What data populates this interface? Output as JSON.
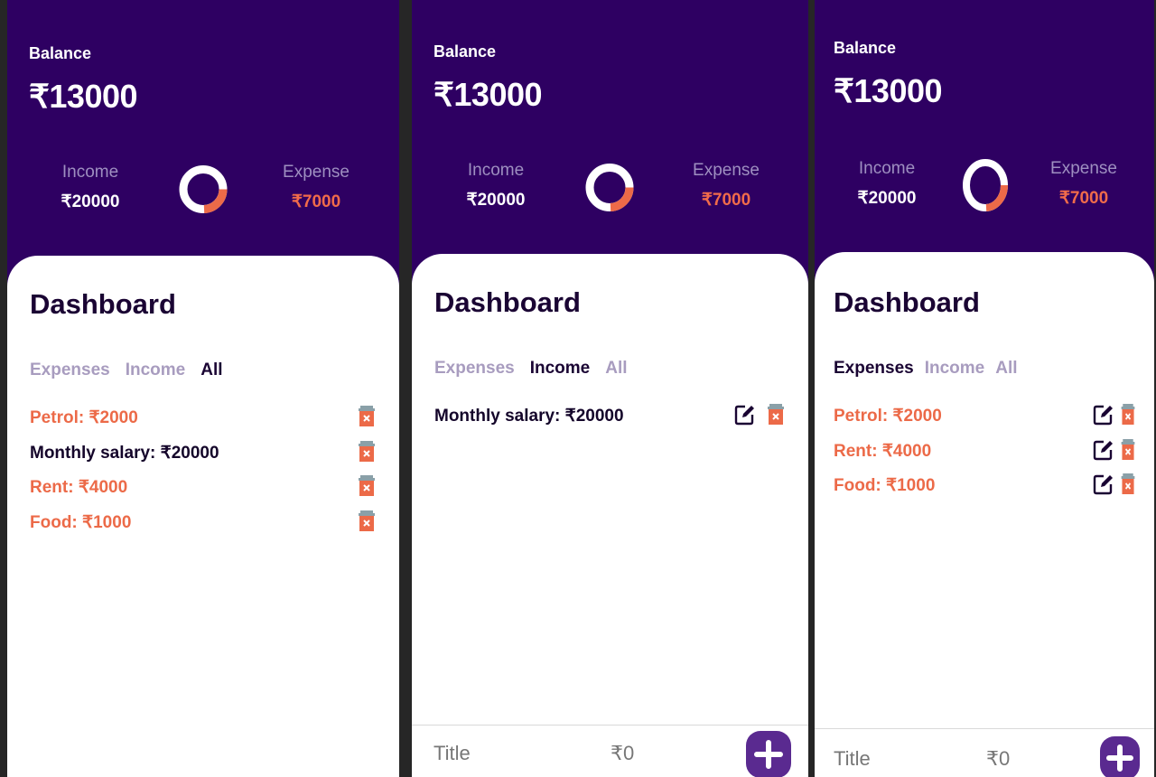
{
  "screens": [
    {
      "balance_label": "Balance",
      "balance": "₹13000",
      "income_label": "Income",
      "income": "₹20000",
      "expense_label": "Expense",
      "expense": "₹7000",
      "dashboard_title": "Dashboard",
      "tabs": [
        "Expenses",
        "Income",
        "All"
      ],
      "active_tab": "All",
      "items": [
        {
          "text": "Petrol: ₹2000",
          "type": "expense"
        },
        {
          "text": "Monthly salary: ₹20000",
          "type": "income"
        },
        {
          "text": "Rent: ₹4000",
          "type": "expense"
        },
        {
          "text": "Food: ₹1000",
          "type": "expense"
        }
      ]
    },
    {
      "balance_label": "Balance",
      "balance": "₹13000",
      "income_label": "Income",
      "income": "₹20000",
      "expense_label": "Expense",
      "expense": "₹7000",
      "dashboard_title": "Dashboard",
      "tabs": [
        "Expenses",
        "Income",
        "All"
      ],
      "active_tab": "Income",
      "items": [
        {
          "text": "Monthly salary: ₹20000",
          "type": "income"
        }
      ],
      "title_placeholder": "Title",
      "amount_placeholder": "₹0"
    },
    {
      "balance_label": "Balance",
      "balance": "₹13000",
      "income_label": "Income",
      "income": "₹20000",
      "expense_label": "Expense",
      "expense": "₹7000",
      "dashboard_title": "Dashboard",
      "tabs": [
        "Expenses",
        "Income",
        "All"
      ],
      "active_tab": "Expenses",
      "items": [
        {
          "text": "Petrol: ₹2000",
          "type": "expense"
        },
        {
          "text": "Rent: ₹4000",
          "type": "expense"
        },
        {
          "text": "Food: ₹1000",
          "type": "expense"
        }
      ],
      "title_placeholder": "Title",
      "amount_placeholder": "₹0"
    }
  ],
  "colors": {
    "header_bg": "#2e0062",
    "expense": "#ec6a48",
    "text_dark": "#1a0433",
    "tab_inactive": "#a89cbf",
    "add_button": "#5a2a90"
  },
  "donut": {
    "income_fraction": 0.741,
    "expense_fraction": 0.259
  }
}
